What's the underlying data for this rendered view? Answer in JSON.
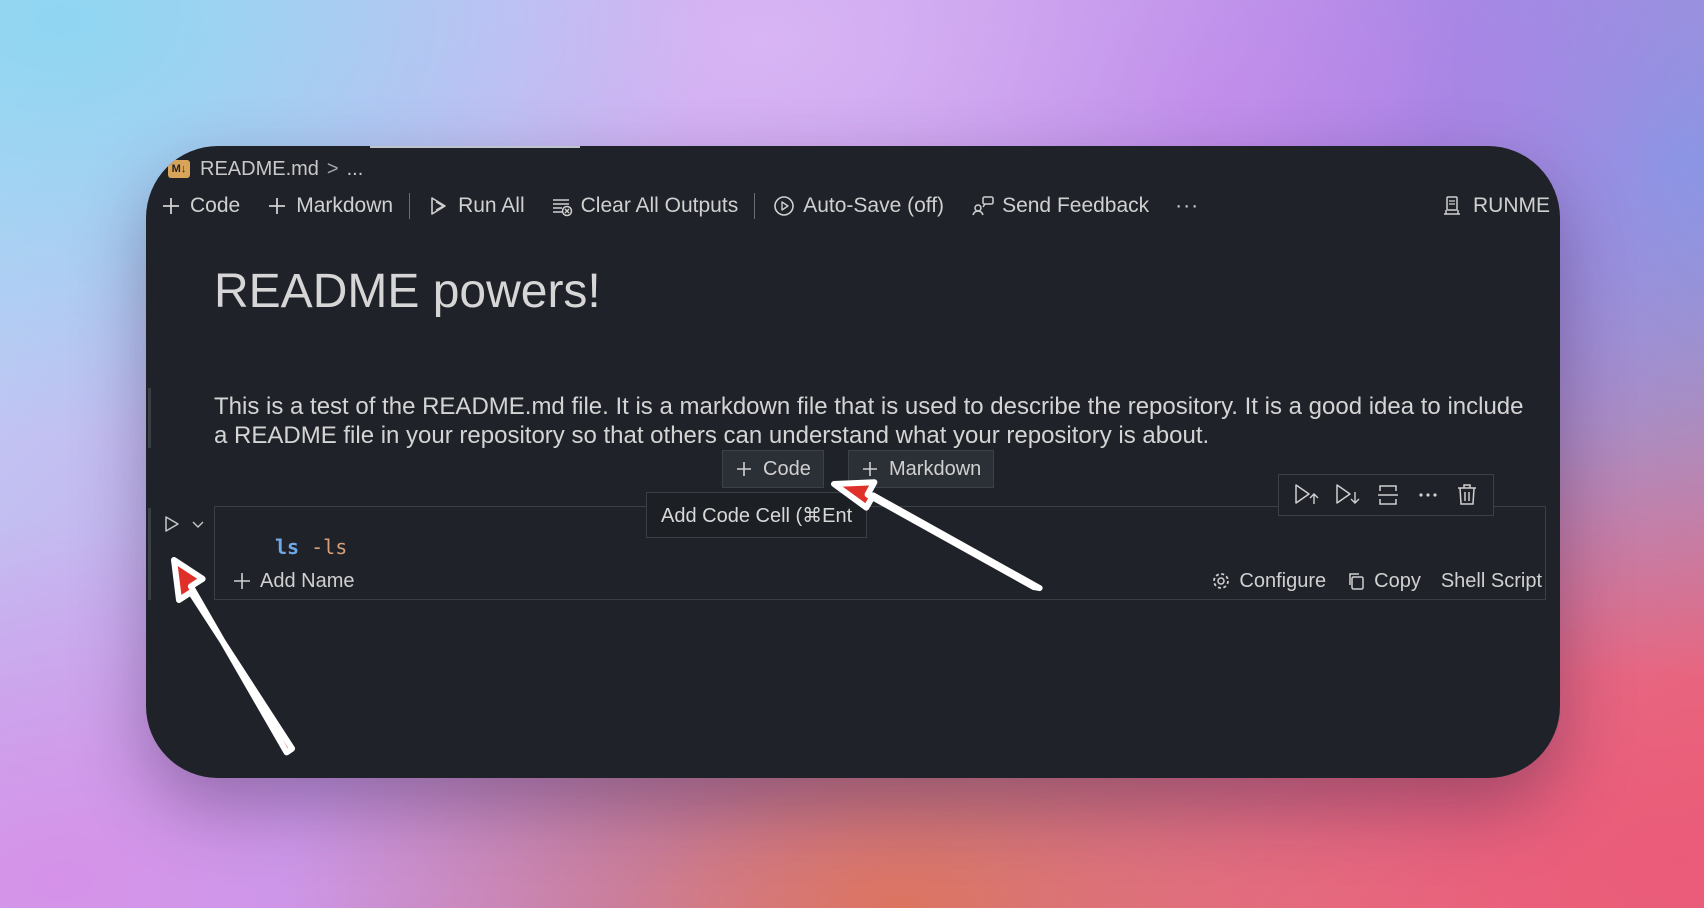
{
  "breadcrumb": {
    "badge": "M↓",
    "file": "README.md",
    "separator": ">",
    "more": "..."
  },
  "toolbar": {
    "code_label": "Code",
    "markdown_label": "Markdown",
    "run_all_label": "Run All",
    "clear_outputs_label": "Clear All Outputs",
    "autosave_label": "Auto-Save (off)",
    "feedback_label": "Send Feedback",
    "more_label": "···",
    "runme_label": "RUNME"
  },
  "markdown_cell": {
    "heading": "README powers!",
    "paragraph": "This is a test of the README.md file. It is a markdown file that is used to describe the repository. It is a good idea to include a README file in your repository so that others can understand what your repository is about."
  },
  "insert_bar": {
    "code_label": "Code",
    "markdown_label": "Markdown",
    "tooltip": "Add Code Cell (⌘Ent"
  },
  "code_cell": {
    "command": "ls",
    "flag": "-ls",
    "add_name_label": "Add Name",
    "configure_label": "Configure",
    "copy_label": "Copy",
    "language_label": "Shell Script"
  },
  "icons": [
    "plus-icon",
    "run-all-icon",
    "clear-outputs-icon",
    "autosave-icon",
    "feedback-icon",
    "more-icon",
    "runme-icon",
    "run-cell-icon",
    "chevron-down-icon",
    "run-above-icon",
    "run-below-icon",
    "split-cell-icon",
    "trash-icon",
    "gear-icon",
    "copy-icon"
  ],
  "colors": {
    "editor_bg": "#1f2228",
    "keyword": "#6fa8e6",
    "flag": "#d7a07a",
    "annotation_arrow": "#e0302a"
  }
}
